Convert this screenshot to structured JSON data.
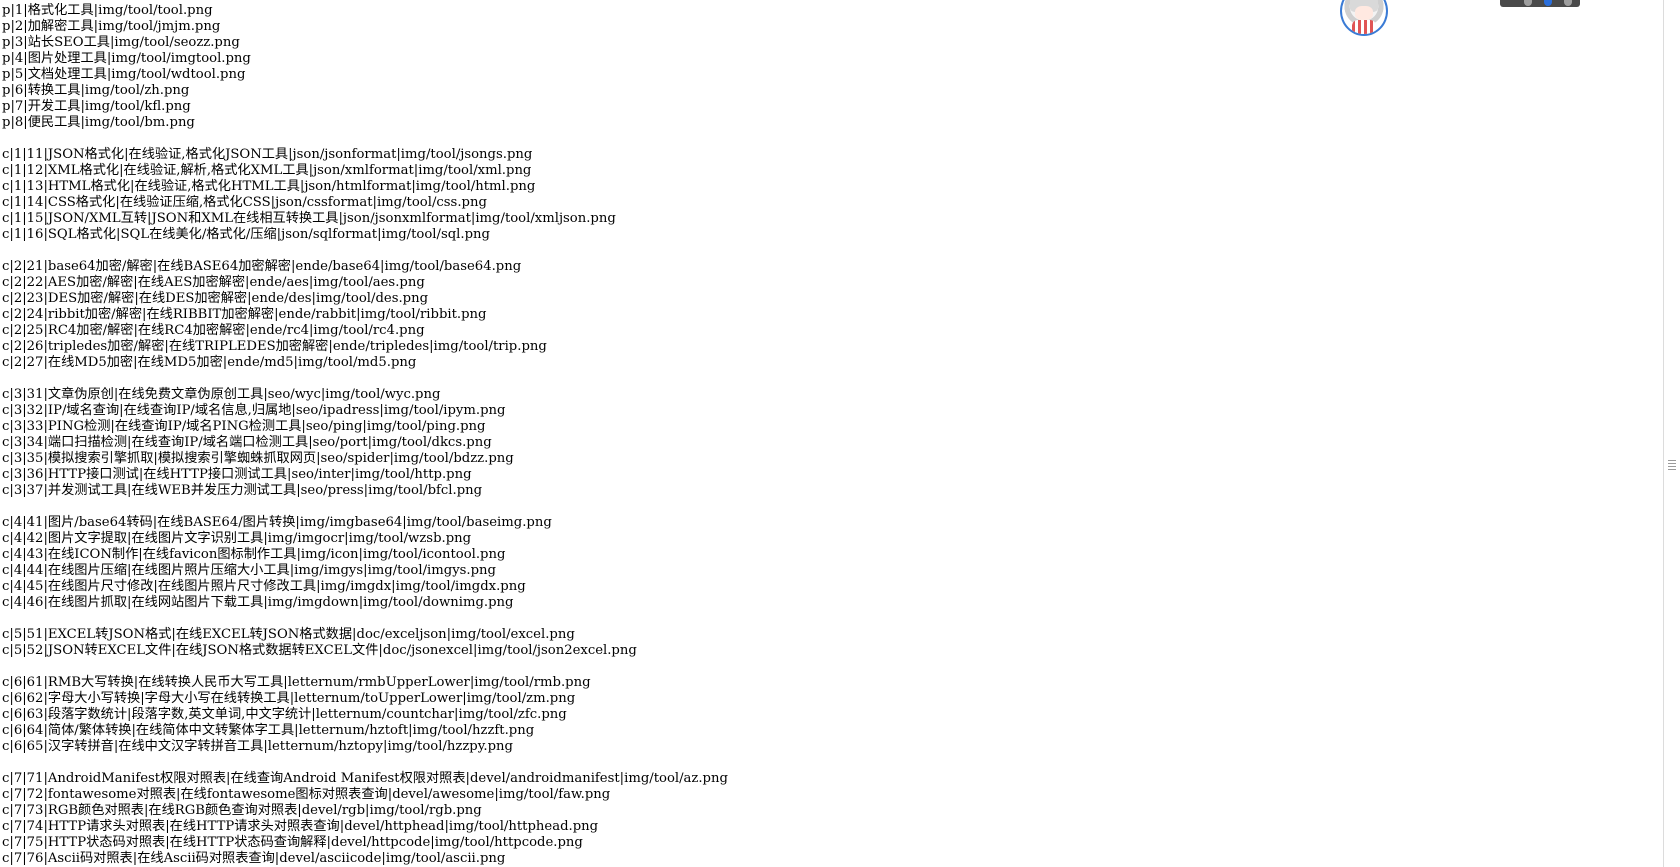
{
  "document": {
    "lines": [
      "p|1|格式化工具|img/tool/tool.png",
      "p|2|加解密工具|img/tool/jmjm.png",
      "p|3|站长SEO工具|img/tool/seozz.png",
      "p|4|图片处理工具|img/tool/imgtool.png",
      "p|5|文档处理工具|img/tool/wdtool.png",
      "p|6|转换工具|img/tool/zh.png",
      "p|7|开发工具|img/tool/kfl.png",
      "p|8|便民工具|img/tool/bm.png",
      "",
      "c|1|11|JSON格式化|在线验证,格式化JSON工具|json/jsonformat|img/tool/jsongs.png",
      "c|1|12|XML格式化|在线验证,解析,格式化XML工具|json/xmlformat|img/tool/xml.png",
      "c|1|13|HTML格式化|在线验证,格式化HTML工具|json/htmlformat|img/tool/html.png",
      "c|1|14|CSS格式化|在线验证压缩,格式化CSS|json/cssformat|img/tool/css.png",
      "c|1|15|JSON/XML互转|JSON和XML在线相互转换工具|json/jsonxmlformat|img/tool/xmljson.png",
      "c|1|16|SQL格式化|SQL在线美化/格式化/压缩|json/sqlformat|img/tool/sql.png",
      "",
      "c|2|21|base64加密/解密|在线BASE64加密解密|ende/base64|img/tool/base64.png",
      "c|2|22|AES加密/解密|在线AES加密解密|ende/aes|img/tool/aes.png",
      "c|2|23|DES加密/解密|在线DES加密解密|ende/des|img/tool/des.png",
      "c|2|24|ribbit加密/解密|在线RIBBIT加密解密|ende/rabbit|img/tool/ribbit.png",
      "c|2|25|RC4加密/解密|在线RC4加密解密|ende/rc4|img/tool/rc4.png",
      "c|2|26|tripledes加密/解密|在线TRIPLEDES加密解密|ende/tripledes|img/tool/trip.png",
      "c|2|27|在线MD5加密|在线MD5加密|ende/md5|img/tool/md5.png",
      "",
      "c|3|31|文章伪原创|在线免费文章伪原创工具|seo/wyc|img/tool/wyc.png",
      "c|3|32|IP/域名查询|在线查询IP/域名信息,归属地|seo/ipadress|img/tool/ipym.png",
      "c|3|33|PING检测|在线查询IP/域名PING检测工具|seo/ping|img/tool/ping.png",
      "c|3|34|端口扫描检测|在线查询IP/域名端口检测工具|seo/port|img/tool/dkcs.png",
      "c|3|35|模拟搜索引擎抓取|模拟搜索引擎蜘蛛抓取网页|seo/spider|img/tool/bdzz.png",
      "c|3|36|HTTP接口测试|在线HTTP接口测试工具|seo/inter|img/tool/http.png",
      "c|3|37|并发测试工具|在线WEB并发压力测试工具|seo/press|img/tool/bfcl.png",
      "",
      "c|4|41|图片/base64转码|在线BASE64/图片转换|img/imgbase64|img/tool/baseimg.png",
      "c|4|42|图片文字提取|在线图片文字识别工具|img/imgocr|img/tool/wzsb.png",
      "c|4|43|在线ICON制作|在线favicon图标制作工具|img/icon|img/tool/icontool.png",
      "c|4|44|在线图片压缩|在线图片照片压缩大小工具|img/imgys|img/tool/imgys.png",
      "c|4|45|在线图片尺寸修改|在线图片照片尺寸修改工具|img/imgdx|img/tool/imgdx.png",
      "c|4|46|在线图片抓取|在线网站图片下载工具|img/imgdown|img/tool/downimg.png",
      "",
      "c|5|51|EXCEL转JSON格式|在线EXCEL转JSON格式数据|doc/exceljson|img/tool/excel.png",
      "c|5|52|JSON转EXCEL文件|在线JSON格式数据转EXCEL文件|doc/jsonexcel|img/tool/json2excel.png",
      "",
      "c|6|61|RMB大写转换|在线转换人民币大写工具|letternum/rmbUpperLower|img/tool/rmb.png",
      "c|6|62|字母大小写转换|字母大小写在线转换工具|letternum/toUpperLower|img/tool/zm.png",
      "c|6|63|段落字数统计|段落字数,英文单词,中文字统计|letternum/countchar|img/tool/zfc.png",
      "c|6|64|简体/繁体转换|在线简体中文转繁体字工具|letternum/hztoft|img/tool/hzzft.png",
      "c|6|65|汉字转拼音|在线中文汉字转拼音工具|letternum/hztopy|img/tool/hzzpy.png",
      "",
      "c|7|71|AndroidManifest权限对照表|在线查询Android Manifest权限对照表|devel/androidmanifest|img/tool/az.png",
      "c|7|72|fontawesome对照表|在线fontawesome图标对照表查询|devel/awesome|img/tool/faw.png",
      "c|7|73|RGB颜色对照表|在线RGB颜色查询对照表|devel/rgb|img/tool/rgb.png",
      "c|7|74|HTTP请求头对照表|在线HTTP请求头对照表查询|devel/httphead|img/tool/httphead.png",
      "c|7|75|HTTP状态码对照表|在线HTTP状态码查询解释|devel/httpcode|img/tool/httpcode.png",
      "c|7|76|Ascii码对照表|在线Ascii码对照表查询|devel/asciicode|img/tool/ascii.png"
    ]
  },
  "icons": {
    "avatar": "user-avatar-icon",
    "scroll_grip": "scroll-grip-icon"
  },
  "colors": {
    "background": "#ffffff",
    "text": "#000000",
    "avatar_border": "#3a7bd5"
  }
}
